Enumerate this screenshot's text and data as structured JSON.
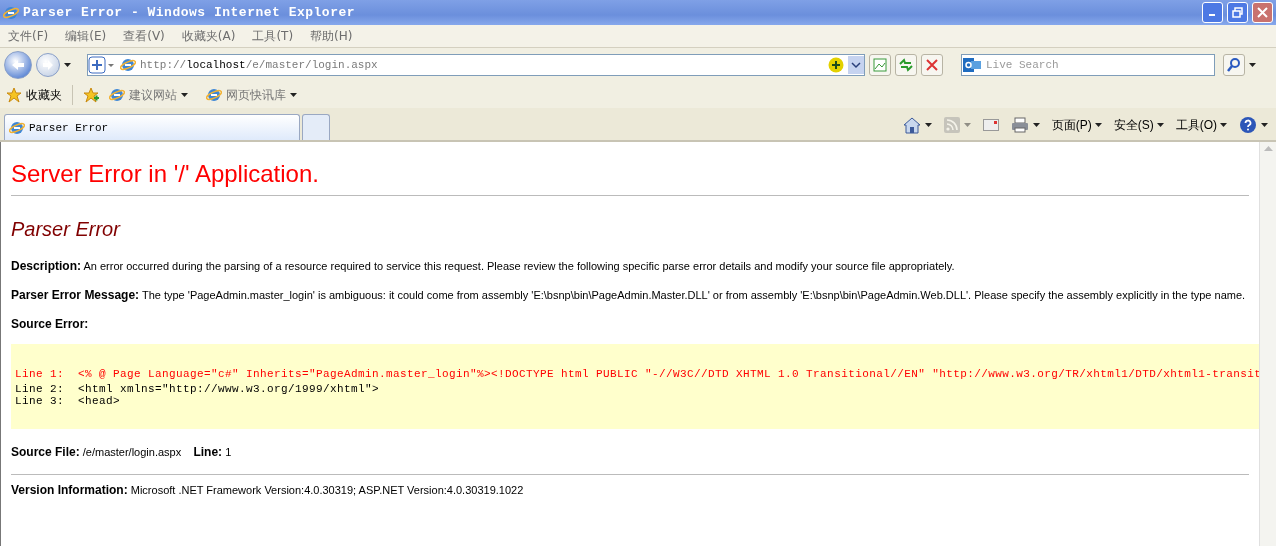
{
  "window": {
    "title": "Parser Error - Windows Internet Explorer"
  },
  "menu": [
    "文件(F)",
    "编辑(E)",
    "查看(V)",
    "收藏夹(A)",
    "工具(T)",
    "帮助(H)"
  ],
  "address": {
    "url": "http://**localhost**/e/master/login.aspx",
    "search_placeholder": "Live Search"
  },
  "favorites_bar": {
    "label": "收藏夹",
    "items": [
      "建议网站",
      "网页快讯库"
    ]
  },
  "tabs": [
    {
      "label": "Parser Error",
      "selected": true
    }
  ],
  "command_bar": [
    {
      "kind": "home"
    },
    {
      "kind": "feed",
      "disabled": true
    },
    {
      "kind": "mail"
    },
    {
      "kind": "print"
    },
    {
      "kind": "text",
      "label": "页面(P)"
    },
    {
      "kind": "text",
      "label": "安全(S)"
    },
    {
      "kind": "text",
      "label": "工具(O)"
    },
    {
      "kind": "help"
    }
  ],
  "page": {
    "heading": "Server Error in '/' Application.",
    "subheading": "Parser Error",
    "paragraphs": [
      "**Description:** An error occurred during the parsing of a resource required to service this request. Please review the following specific parse error details and modify your source file appropriately.",
      "**Parser Error Message:** The type 'PageAdmin.master_login' is ambiguous: it could come from assembly 'E:\\bsnp\\bin\\PageAdmin.Master.DLL' or from assembly 'E:\\bsnp\\bin\\PageAdmin.Web.DLL'. Please specify the assembly explicitly in the type name."
    ],
    "source_error_label": "Source Error:",
    "source_lines": [
      {
        "number": "Line 1:",
        "code": "<% @ Page Language=\"c#\" Inherits=\"PageAdmin.master_login\"%><!DOCTYPE html PUBLIC \"-//W3C//DTD XHTML 1.0 Transitional//EN\" \"http://www.w3.org/TR/xhtml1/DTD/xhtml1-transit",
        "error": true
      },
      {
        "number": "Line 2:",
        "code": "<html xmlns=\"http://www.w3.org/1999/xhtml\">",
        "error": false
      },
      {
        "number": "Line 3:",
        "code": "<head>",
        "error": false
      }
    ],
    "source_file": "**Source File:** /e/master/login.aspx    **Line:** 1",
    "version": "**Version Information:** Microsoft .NET Framework Version:4.0.30319; ASP.NET Version:4.0.30319.1022"
  }
}
